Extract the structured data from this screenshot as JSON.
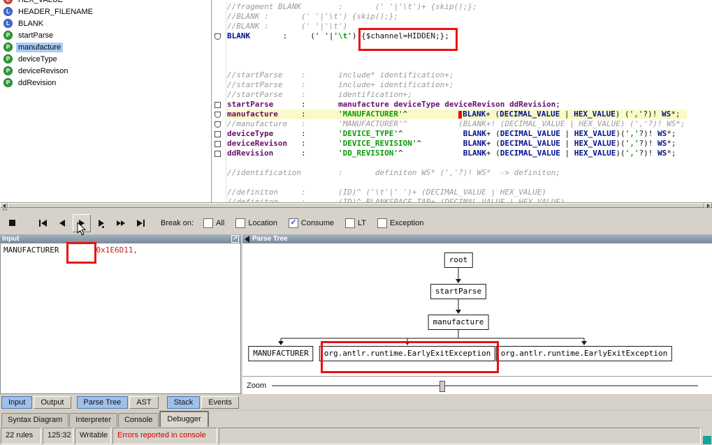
{
  "colors": {
    "annotation_red": "#ea1010",
    "selection_blue": "#a9cbf5",
    "active_view_button": "#9fc0e8",
    "panel_header": "#78899c",
    "error_text": "#d00000",
    "current_line_highlight": "#fafac8",
    "corner_square_teal": "#16a39d"
  },
  "rule_list": {
    "items": [
      {
        "label": "HEX_VALUE",
        "kind": "red"
      },
      {
        "label": "HEADER_FILENAME",
        "kind": "lexer"
      },
      {
        "label": "BLANK",
        "kind": "lexer"
      },
      {
        "label": "startParse",
        "kind": "parser"
      },
      {
        "label": "manufacture",
        "kind": "parser",
        "selected": true
      },
      {
        "label": "deviceType",
        "kind": "parser"
      },
      {
        "label": "deviceRevison",
        "kind": "parser"
      },
      {
        "label": "ddRevision",
        "kind": "parser"
      }
    ]
  },
  "editor": {
    "lines": [
      {
        "segs": [
          {
            "t": "//fragment BLANK        :       (' '|'\\t')+ {skip();};",
            "c": "c"
          }
        ]
      },
      {
        "segs": [
          {
            "t": "//BLANK :       (' '|'\\t') {skip();};",
            "c": "c"
          }
        ]
      },
      {
        "segs": [
          {
            "t": "//BLANK :       (' '|'\\t')",
            "c": "c"
          }
        ]
      },
      {
        "m": "pent",
        "segs": [
          {
            "t": "BLANK",
            "c": "t"
          },
          {
            "t": "       :     (",
            "c": "p"
          },
          {
            "t": "' '",
            "c": "s"
          },
          {
            "t": "|",
            "c": "p"
          },
          {
            "t": "'\\t'",
            "c": "s"
          },
          {
            "t": ") {$channel=HIDDEN;};",
            "c": "p"
          }
        ]
      },
      {},
      {},
      {},
      {
        "segs": [
          {
            "t": "//startParse    :       include* identification+;",
            "c": "c"
          }
        ]
      },
      {
        "segs": [
          {
            "t": "//startParse    :       include+ identification+;",
            "c": "c"
          }
        ]
      },
      {
        "segs": [
          {
            "t": "//startParse    :       identification+;",
            "c": "c"
          }
        ]
      },
      {
        "m": "sq",
        "segs": [
          {
            "t": "startParse",
            "c": "k"
          },
          {
            "t": "      :       ",
            "c": "p"
          },
          {
            "t": "manufacture",
            "c": "k"
          },
          {
            "t": " ",
            "c": "p"
          },
          {
            "t": "deviceType",
            "c": "k"
          },
          {
            "t": " ",
            "c": "p"
          },
          {
            "t": "deviceRevison",
            "c": "k"
          },
          {
            "t": " ",
            "c": "p"
          },
          {
            "t": "ddRevision",
            "c": "k"
          },
          {
            "t": ";",
            "c": "p"
          }
        ]
      },
      {
        "m": "pent",
        "hl": true,
        "segs": [
          {
            "t": "manufacture",
            "c": "k"
          },
          {
            "t": "     :       ",
            "c": "p"
          },
          {
            "t": "'MANUFACTURER'",
            "c": "s"
          },
          {
            "t": "^           ",
            "c": "p"
          },
          {
            "c": "caret"
          },
          {
            "t": "BLANK",
            "c": "t"
          },
          {
            "t": "+ (",
            "c": "p"
          },
          {
            "t": "DECIMAL_VALUE",
            "c": "t"
          },
          {
            "t": " | ",
            "c": "p"
          },
          {
            "t": "HEX_VALUE",
            "c": "t"
          },
          {
            "t": ") (",
            "c": "p"
          },
          {
            "t": "','",
            "c": "s"
          },
          {
            "t": "?)! ",
            "c": "p"
          },
          {
            "t": "WS",
            "c": "t"
          },
          {
            "t": "*;",
            "c": "p"
          }
        ]
      },
      {
        "m": "pent",
        "segs": [
          {
            "t": "//manufacture   :       'MANUFACTURER'^           (BLANK+! (DECIMAL_VALUE | HEX_VALUE) (','?)! WS*;",
            "c": "c"
          }
        ]
      },
      {
        "m": "sq",
        "segs": [
          {
            "t": "deviceType",
            "c": "k"
          },
          {
            "t": "      :       ",
            "c": "p"
          },
          {
            "t": "'DEVICE_TYPE'",
            "c": "s"
          },
          {
            "t": "^             ",
            "c": "p"
          },
          {
            "t": "BLANK",
            "c": "t"
          },
          {
            "t": "+ (",
            "c": "p"
          },
          {
            "t": "DECIMAL_VALUE",
            "c": "t"
          },
          {
            "t": " | ",
            "c": "p"
          },
          {
            "t": "HEX_VALUE",
            "c": "t"
          },
          {
            "t": ")(",
            "c": "p"
          },
          {
            "t": "','",
            "c": "s"
          },
          {
            "t": "?)! ",
            "c": "p"
          },
          {
            "t": "WS",
            "c": "t"
          },
          {
            "t": "*;",
            "c": "p"
          }
        ]
      },
      {
        "m": "sq",
        "segs": [
          {
            "t": "deviceRevison",
            "c": "k"
          },
          {
            "t": "   :       ",
            "c": "p"
          },
          {
            "t": "'DEVICE_REVISION'",
            "c": "s"
          },
          {
            "t": "^         ",
            "c": "p"
          },
          {
            "t": "BLANK",
            "c": "t"
          },
          {
            "t": "+ (",
            "c": "p"
          },
          {
            "t": "DECIMAL_VALUE",
            "c": "t"
          },
          {
            "t": " | ",
            "c": "p"
          },
          {
            "t": "HEX_VALUE",
            "c": "t"
          },
          {
            "t": ")(",
            "c": "p"
          },
          {
            "t": "','",
            "c": "s"
          },
          {
            "t": "?)! ",
            "c": "p"
          },
          {
            "t": "WS",
            "c": "t"
          },
          {
            "t": "*;",
            "c": "p"
          }
        ]
      },
      {
        "m": "sq",
        "segs": [
          {
            "t": "ddRevision",
            "c": "k"
          },
          {
            "t": "      :       ",
            "c": "p"
          },
          {
            "t": "'DD_REVISION'",
            "c": "s"
          },
          {
            "t": "^             ",
            "c": "p"
          },
          {
            "t": "BLANK",
            "c": "t"
          },
          {
            "t": "+ (",
            "c": "p"
          },
          {
            "t": "DECIMAL_VALUE",
            "c": "t"
          },
          {
            "t": " | ",
            "c": "p"
          },
          {
            "t": "HEX_VALUE",
            "c": "t"
          },
          {
            "t": ")(",
            "c": "p"
          },
          {
            "t": "','",
            "c": "s"
          },
          {
            "t": "?)! ",
            "c": "p"
          },
          {
            "t": "WS",
            "c": "t"
          },
          {
            "t": "*;",
            "c": "p"
          }
        ]
      },
      {},
      {
        "segs": [
          {
            "t": "//identification        :       definiton WS* (','?)! WS*  -> definiton;",
            "c": "c"
          }
        ]
      },
      {},
      {
        "segs": [
          {
            "t": "//definiton     :       (ID)^ ('\\t'|' ')+ (DECIMAL_VALUE | HEX_VALUE)",
            "c": "c"
          }
        ]
      },
      {
        "segs": [
          {
            "t": "//definiton     :       (ID)^ BLANKSPACE_TAB+ (DECIMAL_VALUE | HEX_VALUE)",
            "c": "c"
          }
        ]
      }
    ]
  },
  "toolbar": {
    "buttons": [
      {
        "name": "stop"
      },
      {
        "name": "go-to-start"
      },
      {
        "name": "step-back"
      },
      {
        "name": "step-forward",
        "pressed": true
      },
      {
        "name": "step-over"
      },
      {
        "name": "fast-forward"
      },
      {
        "name": "go-to-end"
      }
    ],
    "break_on_label": "Break on:",
    "checkboxes": [
      {
        "label": "All",
        "checked": false
      },
      {
        "label": "Location",
        "checked": false
      },
      {
        "label": "Consume",
        "checked": true
      },
      {
        "label": "LT",
        "checked": false
      },
      {
        "label": "Exception",
        "checked": false
      }
    ]
  },
  "input_panel": {
    "title": "Input",
    "segments": [
      {
        "t": "MANUFACTURER",
        "c": "p"
      },
      {
        "t": "        ",
        "c": "p"
      },
      {
        "t": "0x1E6D11,",
        "c": "red"
      }
    ]
  },
  "parse_tree_panel": {
    "title": "Parse Tree",
    "nodes": [
      "root",
      "startParse",
      "manufacture",
      "MANUFACTURER",
      "org.antlr.runtime.EarlyExitException",
      "org.antlr.runtime.EarlyExitException"
    ],
    "zoom_label": "Zoom"
  },
  "view_buttons": [
    {
      "label": "Input",
      "active": true
    },
    {
      "label": "Output",
      "active": false
    },
    {
      "label": "Parse Tree",
      "active": true
    },
    {
      "label": "AST",
      "active": false
    },
    {
      "label": "Stack",
      "active": true
    },
    {
      "label": "Events",
      "active": false
    }
  ],
  "bottom_tabs": [
    {
      "label": "Syntax Diagram",
      "active": false
    },
    {
      "label": "Interpreter",
      "active": false
    },
    {
      "label": "Console",
      "active": false
    },
    {
      "label": "Debugger",
      "active": true
    }
  ],
  "status_bar": {
    "rules": "22 rules",
    "position": "125:32",
    "writable": "Writable",
    "message": "Errors reported in console"
  }
}
